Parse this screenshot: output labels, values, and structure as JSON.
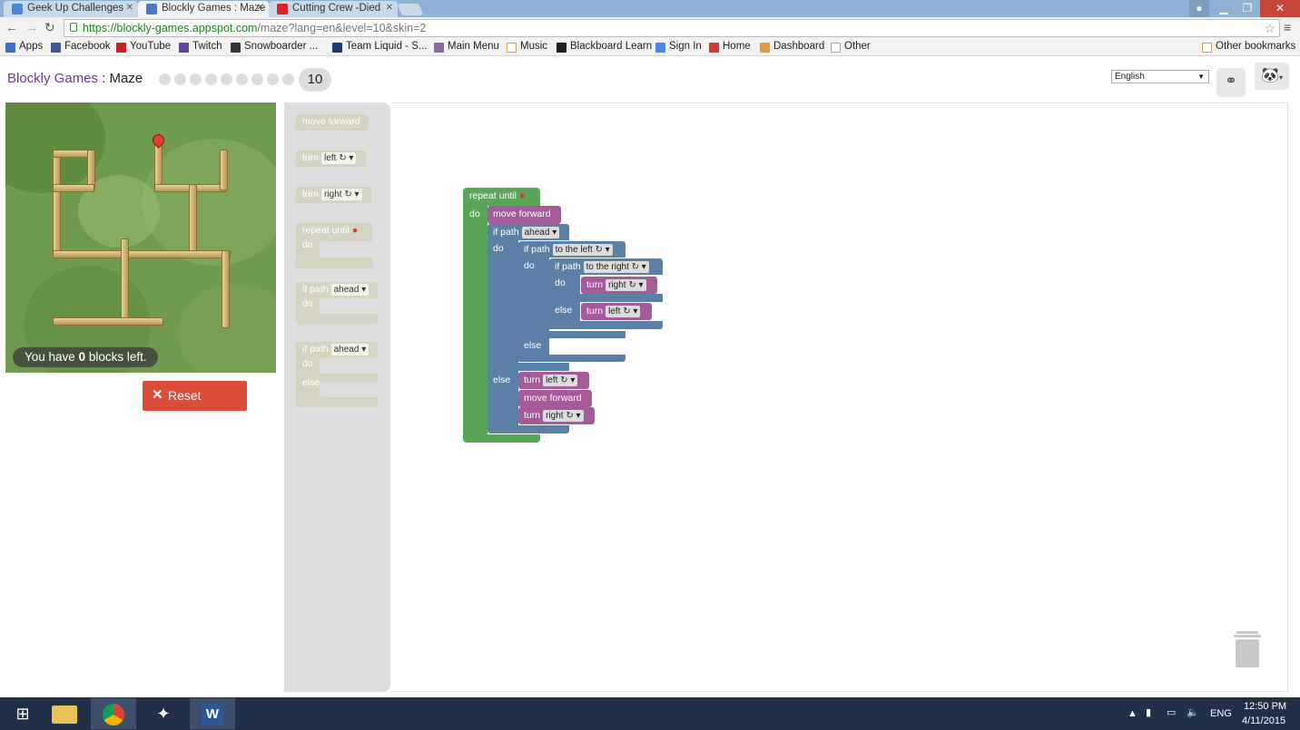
{
  "browser": {
    "tabs": [
      {
        "title": "Geek Up Challenges",
        "icon_color": "#4a86d6",
        "active": false
      },
      {
        "title": "Blockly Games : Maze",
        "icon_color": "#4a7bc4",
        "active": true
      },
      {
        "title": "Cutting Crew -Died",
        "icon_color": "#d22",
        "active": false
      }
    ],
    "url_host": "https://blockly-games.appspot.com",
    "url_rest": "/maze?lang=en&level=10&skin=2",
    "bookmarks": [
      {
        "label": "Apps",
        "icon": "apps-grid-icon",
        "color": "#3b6fc6"
      },
      {
        "label": "Facebook",
        "icon": "facebook-icon",
        "color": "#3b5998"
      },
      {
        "label": "YouTube",
        "icon": "youtube-icon",
        "color": "#cc1f1f"
      },
      {
        "label": "Twitch",
        "icon": "twitch-icon",
        "color": "#6441a4"
      },
      {
        "label": "Snowboarder ...",
        "icon": "snowboarder-icon",
        "color": "#333333"
      },
      {
        "label": "Team Liquid - S...",
        "icon": "team-liquid-icon",
        "color": "#1e3a6e"
      },
      {
        "label": "Main Menu",
        "icon": "main-menu-icon",
        "color": "#8a6a9a"
      },
      {
        "label": "Music",
        "icon": "folder-icon",
        "color": "#c9a44a"
      },
      {
        "label": "Blackboard Learn",
        "icon": "blackboard-icon",
        "color": "#222222"
      },
      {
        "label": "Sign In",
        "icon": "google-icon",
        "color": "#4a86e8"
      },
      {
        "label": "Home",
        "icon": "home-icon",
        "color": "#d33"
      },
      {
        "label": "Dashboard",
        "icon": "dashboard-icon",
        "color": "#e89a3a"
      },
      {
        "label": "Other",
        "icon": "folder-icon",
        "color": "#c9a44a"
      }
    ],
    "other_bookmarks": "Other bookmarks"
  },
  "header": {
    "app_name": "Blockly Games",
    "separator": " : ",
    "page_name": "Maze",
    "current_level": "10",
    "level_count": 10,
    "language": "English"
  },
  "maze": {
    "blocks_left_prefix": "You have ",
    "blocks_left_count": "0",
    "blocks_left_suffix": " blocks left.",
    "reset_label": "Reset"
  },
  "toolbox": {
    "move_forward": "move forward",
    "turn": "turn",
    "left": "left ↻",
    "right": "right ↻",
    "repeat_until": "repeat until",
    "do": "do",
    "if_path": "if path",
    "ahead": "ahead",
    "else": "else"
  },
  "program": {
    "repeat_until": "repeat until",
    "do": "do",
    "move_forward": "move forward",
    "if_path": "if path",
    "ahead": "ahead",
    "to_the_left": "to the left ↻",
    "to_the_right": "to the right ↻",
    "turn": "turn",
    "right": "right ↻",
    "left": "left ↻",
    "else": "else"
  },
  "taskbar": {
    "language": "ENG",
    "time": "12:50 PM",
    "date": "4/11/2015"
  }
}
